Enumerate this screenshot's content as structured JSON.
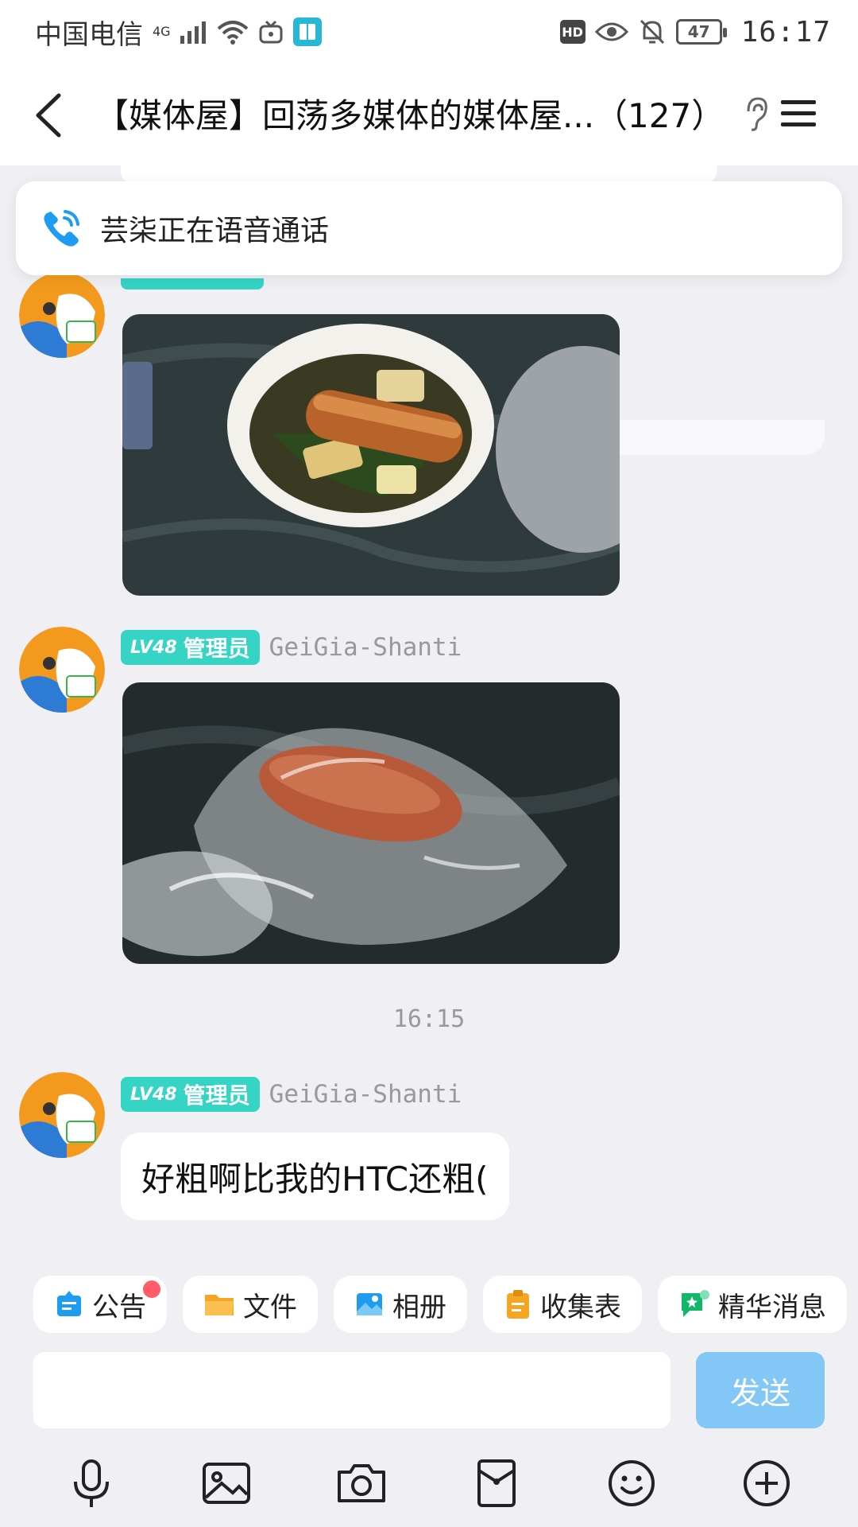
{
  "status_bar": {
    "carrier": "中国电信",
    "network": "4G",
    "hd": "HD",
    "battery": "47",
    "time": "16:17"
  },
  "header": {
    "title": "【媒体屋】回荡多媒体的媒体屋...（127）"
  },
  "call_banner": {
    "text": "芸柒正在语音通话"
  },
  "messages": [
    {
      "type": "image",
      "content": "food bowl photo"
    },
    {
      "type": "image",
      "level": "LV48",
      "role": "管理员",
      "sender": "GeiGia-Shanti",
      "content": "sausage in plastic bag photo"
    },
    {
      "type": "time",
      "time": "16:15"
    },
    {
      "type": "text",
      "level": "LV48",
      "role": "管理员",
      "sender": "GeiGia-Shanti",
      "text": "好粗啊比我的HTC还粗("
    }
  ],
  "toolbar": {
    "chips": [
      "公告",
      "文件",
      "相册",
      "收集表",
      "精华消息"
    ]
  },
  "input": {
    "value": "",
    "send_label": "发送"
  },
  "colors": {
    "badge": "#36D4C5",
    "send_disabled": "#83C7F6",
    "background": "#EFEFF4",
    "accent_blue": "#1E9CF0"
  }
}
